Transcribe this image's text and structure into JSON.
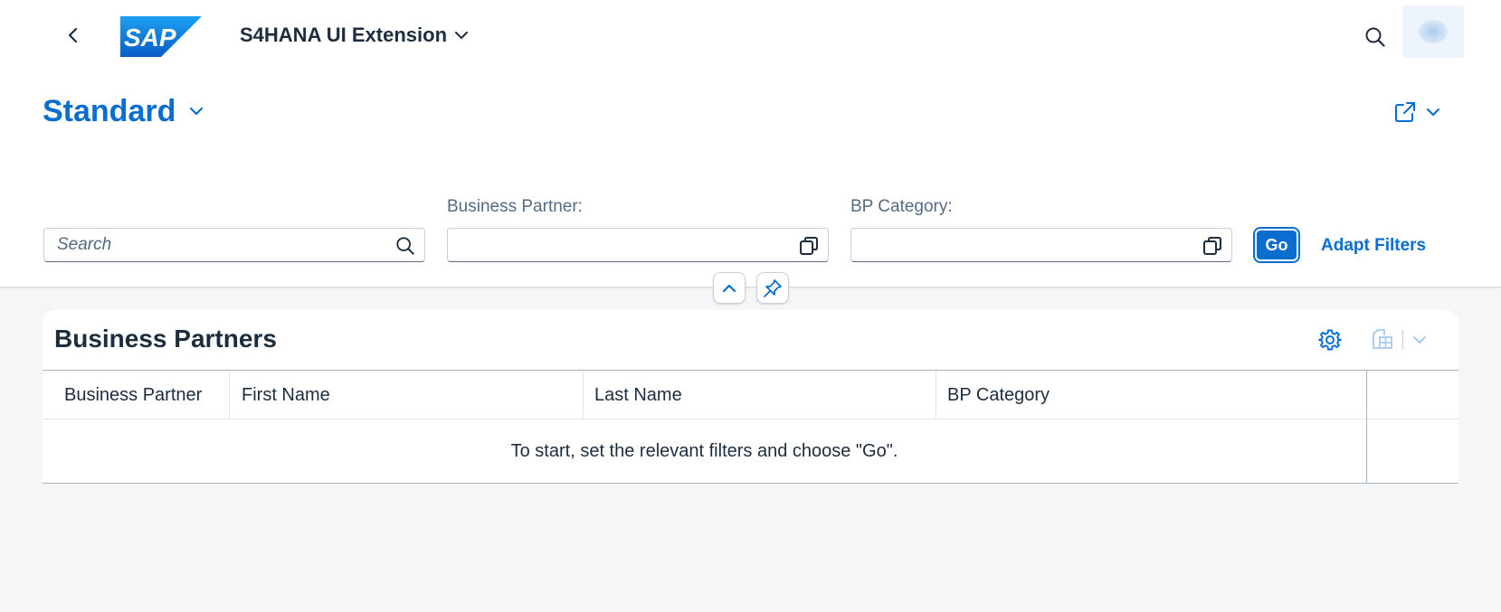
{
  "shell": {
    "app_title": "S4HANA UI Extension",
    "logo_text": "SAP"
  },
  "header": {
    "variant": "Standard"
  },
  "filters": {
    "search_placeholder": "Search",
    "business_partner_label": "Business Partner:",
    "business_partner_value": "",
    "bp_category_label": "BP Category:",
    "bp_category_value": "",
    "go_label": "Go",
    "adapt_filters_label": "Adapt Filters"
  },
  "table": {
    "title": "Business Partners",
    "columns": [
      "Business Partner",
      "First Name",
      "Last Name",
      "BP Category"
    ],
    "no_data_text": "To start, set the relevant filters and choose \"Go\"."
  },
  "colors": {
    "accent": "#0a6ed1",
    "text": "#1d2d3e",
    "background": "#f5f6f7"
  },
  "icons": [
    "back-icon",
    "chevron-down-icon",
    "search-icon",
    "share-icon",
    "value-help-icon",
    "collapse-icon",
    "pin-icon",
    "settings-icon",
    "export-icon"
  ]
}
